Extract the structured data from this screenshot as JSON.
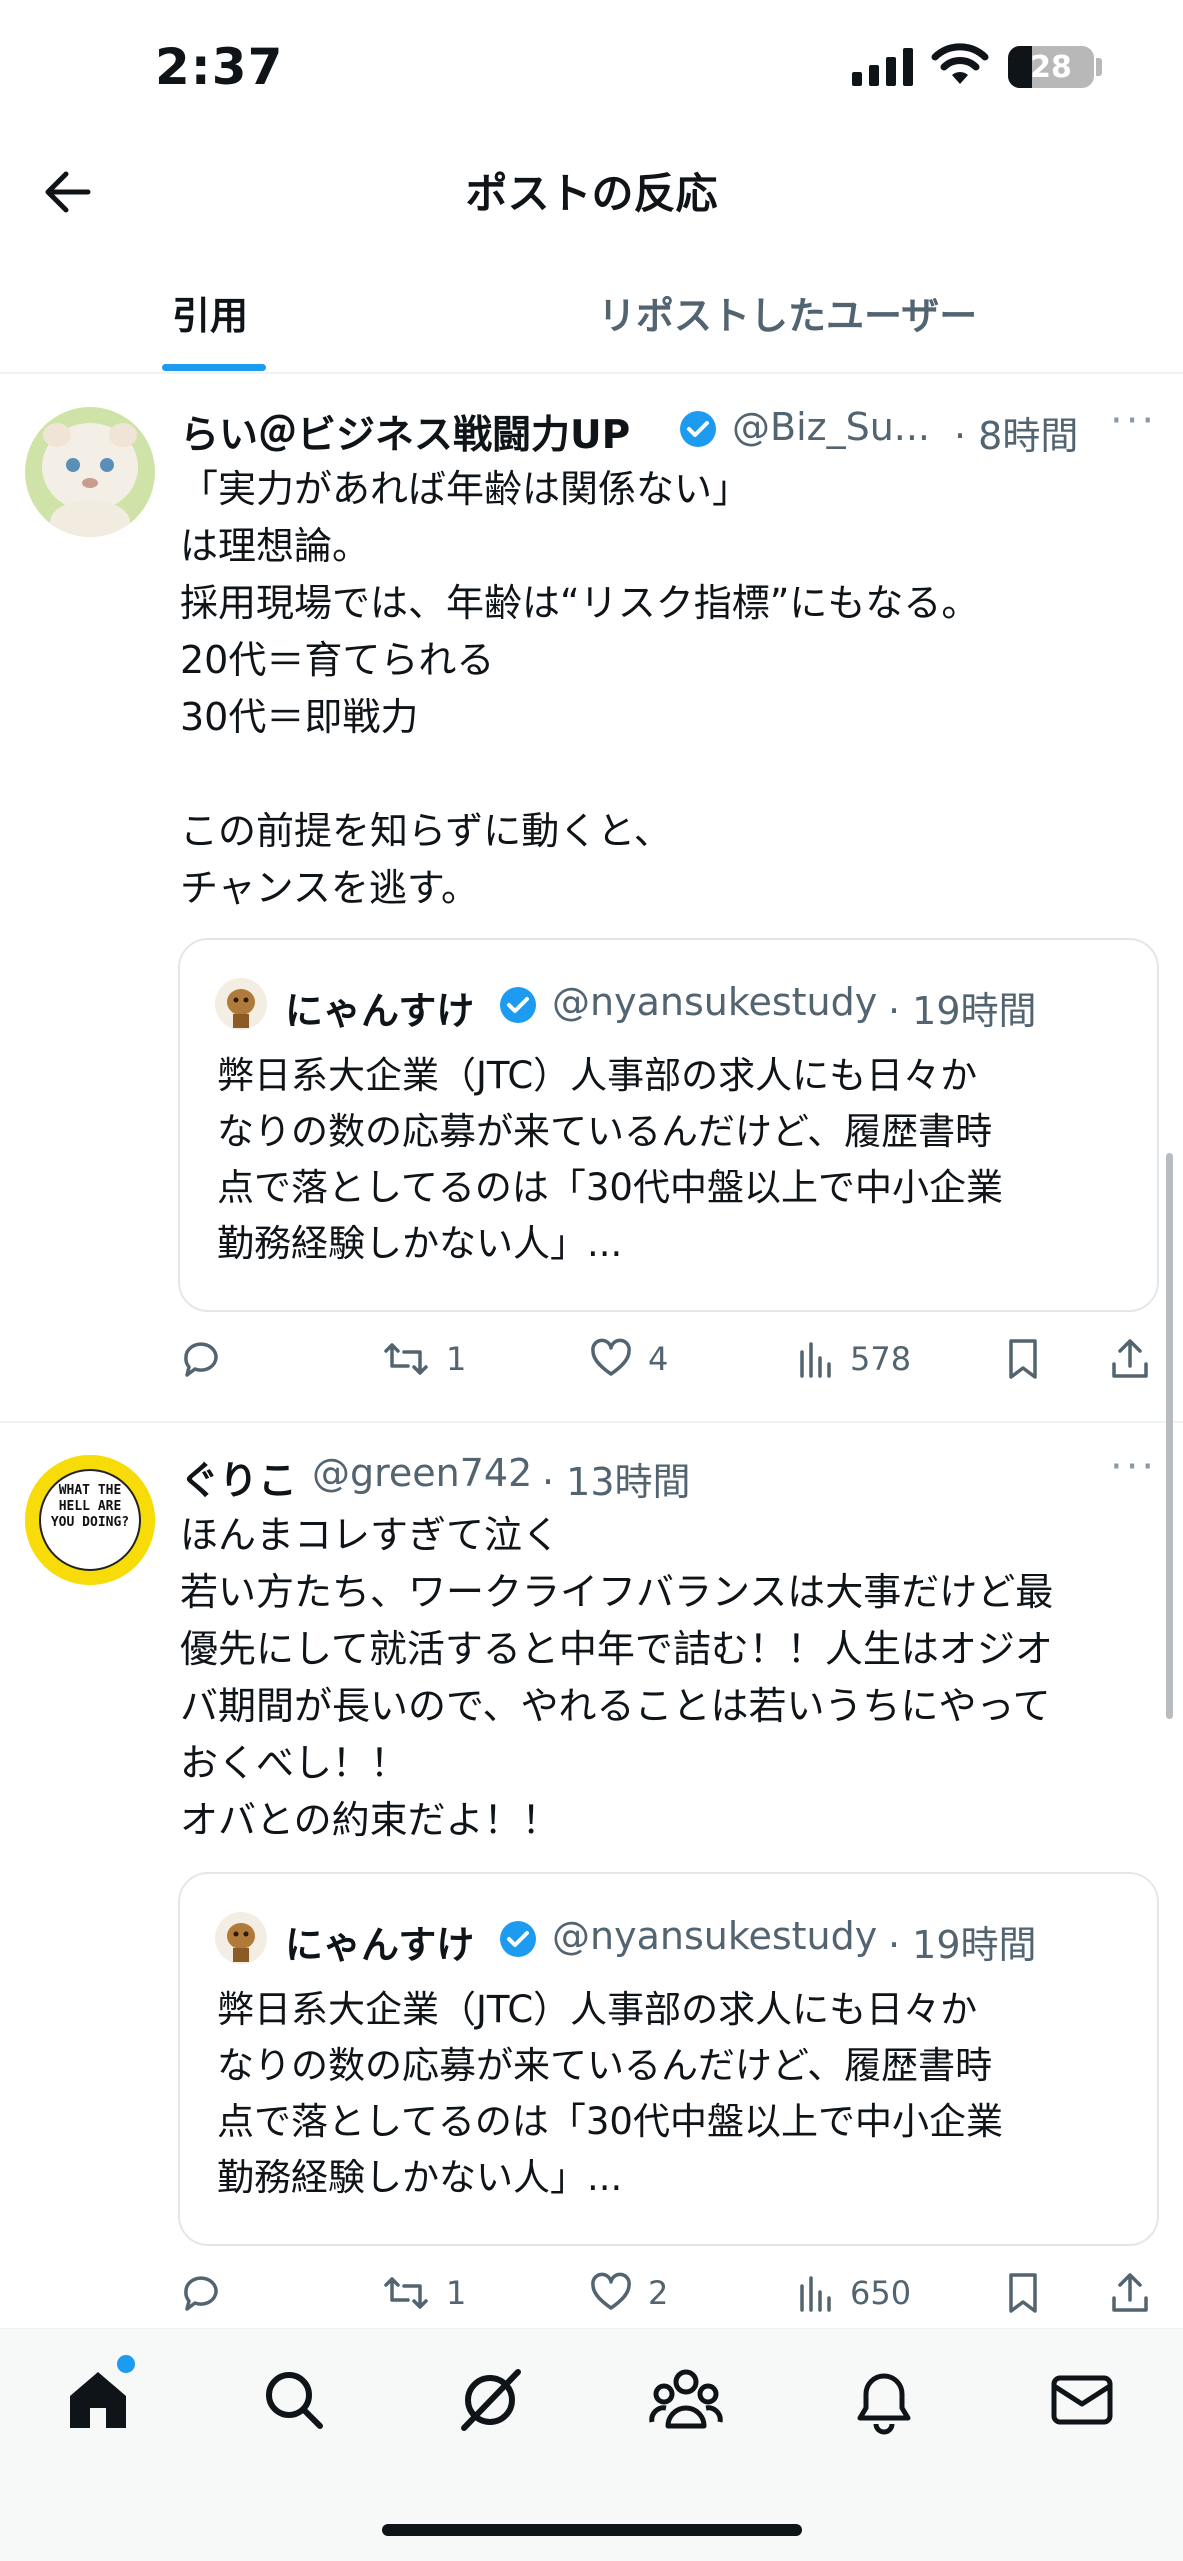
{
  "status_bar": {
    "time": "2:37",
    "battery": "28"
  },
  "header": {
    "title": "ポストの反応"
  },
  "tabs": [
    {
      "label": "引用",
      "active": true
    },
    {
      "label": "リポストしたユーザー",
      "active": false
    }
  ],
  "posts": [
    {
      "name": "らい＠ビジネス戦闘力UP",
      "handle": "@Biz_Su...",
      "time": "· 8時間",
      "text": "「実力があれば年齢は関係ない」\nは理想論。\n採用現場では、年齢は“リスク指標”にもなる。\n20代＝育てられる\n30代＝即戦力\n\nこの前提を知らずに動くと、\nチャンスを逃す。",
      "quote": {
        "name": "にゃんすけ",
        "handle": "@nyansukestudy",
        "time": "· 19時間",
        "text": "弊日系大企業（JTC）人事部の求人にも日々か\nなりの数の応募が来ているんだけど、履歴書時\n点で落としてるのは「30代中盤以上で中小企業\n勤務経験しかない人」..."
      },
      "stats": {
        "replies": "",
        "reposts": "1",
        "likes": "4",
        "views": "578"
      }
    },
    {
      "name": "ぐりこ",
      "handle": "@green742",
      "time": "· 13時間",
      "avatar_text": "WHAT THE HELL ARE YOU DOING?",
      "text": "ほんまコレすぎて泣く\n若い方たち、ワークライフバランスは大事だけど最\n優先にして就活すると中年で詰む！！人生はオジオ\nバ期間が長いので、やれることは若いうちにやって\nおくべし！！\nオバとの約束だよ！！",
      "quote": {
        "name": "にゃんすけ",
        "handle": "@nyansukestudy",
        "time": "· 19時間",
        "text": "弊日系大企業（JTC）人事部の求人にも日々か\nなりの数の応募が来ているんだけど、履歴書時\n点で落としてるのは「30代中盤以上で中小企業\n勤務経験しかない人」..."
      },
      "stats": {
        "replies": "",
        "reposts": "1",
        "likes": "2",
        "views": "650"
      }
    }
  ],
  "colors": {
    "accent": "#1d9bf0",
    "text": "#0f1419",
    "secondary": "#536471"
  },
  "icons": [
    "back-arrow-icon",
    "reply-icon",
    "repost-icon",
    "like-icon",
    "views-icon",
    "bookmark-icon",
    "share-icon",
    "home-icon",
    "search-icon",
    "grok-icon",
    "communities-icon",
    "notifications-icon",
    "messages-icon",
    "verified-badge-icon",
    "more-icon"
  ]
}
